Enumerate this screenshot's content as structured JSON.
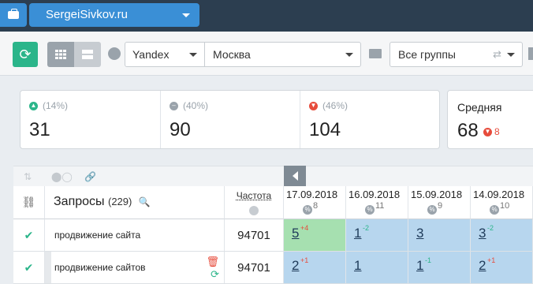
{
  "header": {
    "site": "SergeiSivkov.ru"
  },
  "toolbar": {
    "engine": "Yandex",
    "city": "Москва",
    "groups": "Все группы"
  },
  "stats": {
    "items": [
      {
        "trend": "up",
        "pct": "(14%)",
        "value": "31"
      },
      {
        "trend": "same",
        "pct": "(40%)",
        "value": "90"
      },
      {
        "trend": "down",
        "pct": "(46%)",
        "value": "104"
      }
    ],
    "average": {
      "label": "Средняя",
      "value": "68",
      "delta": "8",
      "delta_dir": "down"
    }
  },
  "table": {
    "queries_label": "Запросы",
    "queries_count": "(229)",
    "freq_label": "Частота",
    "dates": [
      {
        "date": "17.09.2018",
        "pct": "8"
      },
      {
        "date": "16.09.2018",
        "pct": "11"
      },
      {
        "date": "15.09.2018",
        "pct": "9"
      },
      {
        "date": "14.09.2018",
        "pct": "10"
      }
    ],
    "rows": [
      {
        "query": "продвижение сайта",
        "freq": "94701",
        "positions": [
          {
            "pos": "5",
            "change": "+4",
            "dir": "up"
          },
          {
            "pos": "1",
            "change": "-2",
            "dir": "down"
          },
          {
            "pos": "3",
            "change": "",
            "dir": ""
          },
          {
            "pos": "3",
            "change": "-2",
            "dir": "down"
          }
        ]
      },
      {
        "query": "продвижение сайтов",
        "freq": "94701",
        "positions": [
          {
            "pos": "2",
            "change": "+1",
            "dir": "up"
          },
          {
            "pos": "1",
            "change": "",
            "dir": ""
          },
          {
            "pos": "1",
            "change": "-1",
            "dir": "down"
          },
          {
            "pos": "2",
            "change": "+1",
            "dir": "up"
          }
        ]
      }
    ]
  },
  "colors": {
    "accent_blue": "#3a8fd6",
    "green": "#2bb58a",
    "red": "#e74c3c",
    "cell_green": "#a6e0b0",
    "cell_blue": "#b7d6ee"
  }
}
